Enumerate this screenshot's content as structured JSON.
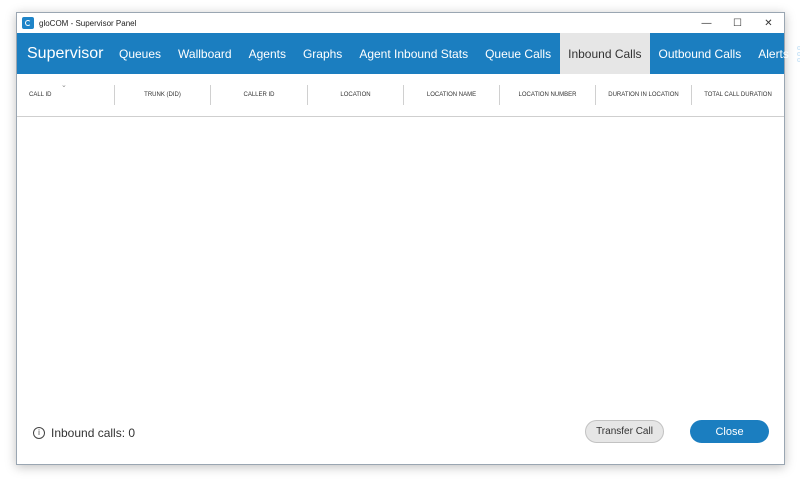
{
  "window": {
    "title": "gloCOM - Supervisor Panel",
    "controls": {
      "minimize": "—",
      "maximize": "☐",
      "close": "✕"
    }
  },
  "nav": {
    "brand": "Supervisor",
    "tabs": [
      {
        "label": "Queues",
        "active": false
      },
      {
        "label": "Wallboard",
        "active": false
      },
      {
        "label": "Agents",
        "active": false
      },
      {
        "label": "Graphs",
        "active": false
      },
      {
        "label": "Agent Inbound Stats",
        "active": false
      },
      {
        "label": "Queue Calls",
        "active": false
      },
      {
        "label": "Inbound Calls",
        "active": true
      },
      {
        "label": "Outbound Calls",
        "active": false
      },
      {
        "label": "Alerts",
        "active": false
      }
    ],
    "more_icon": "more-vertical-icon"
  },
  "table": {
    "sort_indicator": "⌄",
    "columns": [
      "CALL ID",
      "TRUNK (DID)",
      "CALLER ID",
      "LOCATION",
      "LOCATION NAME",
      "LOCATION NUMBER",
      "DURATION IN LOCATION",
      "TOTAL CALL DURATION"
    ],
    "rows": []
  },
  "footer": {
    "status_icon": "info-icon",
    "status_text": "Inbound calls: 0",
    "transfer_label": "Transfer Call",
    "close_label": "Close"
  },
  "colors": {
    "accent": "#1b7ec0",
    "active_tab_bg": "#e6e6e6"
  }
}
